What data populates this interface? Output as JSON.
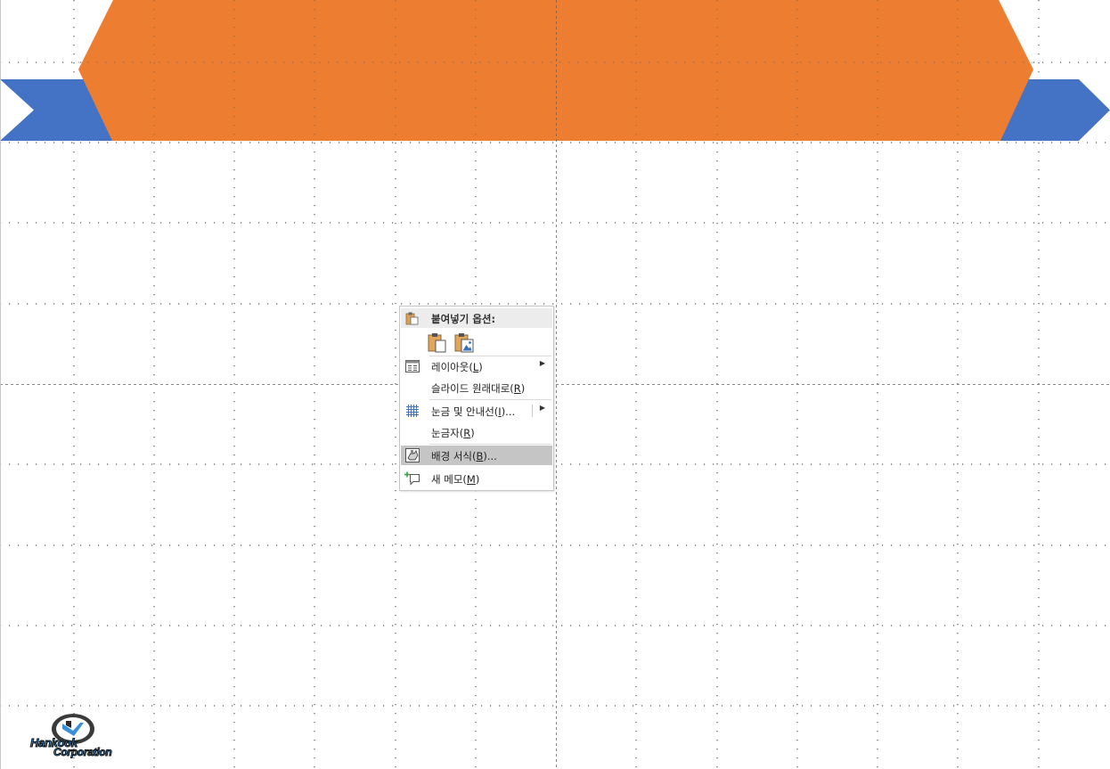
{
  "context_menu": {
    "paste_header": "붙여넣기 옵션:",
    "paste_options": [
      {
        "name": "use-destination-theme",
        "icon": "clipboard-page-icon"
      },
      {
        "name": "picture",
        "icon": "clipboard-picture-icon"
      }
    ],
    "items": [
      {
        "label_main": "레이아웃(",
        "mnemonic": "L",
        "label_tail": ")",
        "icon": "layout-icon",
        "submenu": true
      },
      {
        "label_main": "슬라이드 원래대로(",
        "mnemonic": "R",
        "label_tail": ")",
        "icon": "",
        "submenu": false
      },
      {
        "label_main": "눈금 및 안내선(",
        "mnemonic": "I",
        "label_tail": ")...",
        "icon": "grid-icon",
        "submenu": true
      },
      {
        "label_main": "눈금자(",
        "mnemonic": "R",
        "label_tail": ")",
        "icon": "",
        "submenu": false
      },
      {
        "label_main": "배경 서식(",
        "mnemonic": "B",
        "label_tail": ")...",
        "icon": "format-background-icon",
        "submenu": false,
        "highlighted": true
      },
      {
        "label_main": "새 메모(",
        "mnemonic": "M",
        "label_tail": ")",
        "icon": "new-comment-icon",
        "submenu": false
      }
    ],
    "submenu_arrow": "▶"
  },
  "logo": {
    "text_top": "Hankook",
    "text_bottom": "Corporation"
  },
  "colors": {
    "banner_orange": "#ED7D31",
    "ribbon_blue": "#4472C4",
    "highlight": "#C5C5C5"
  }
}
